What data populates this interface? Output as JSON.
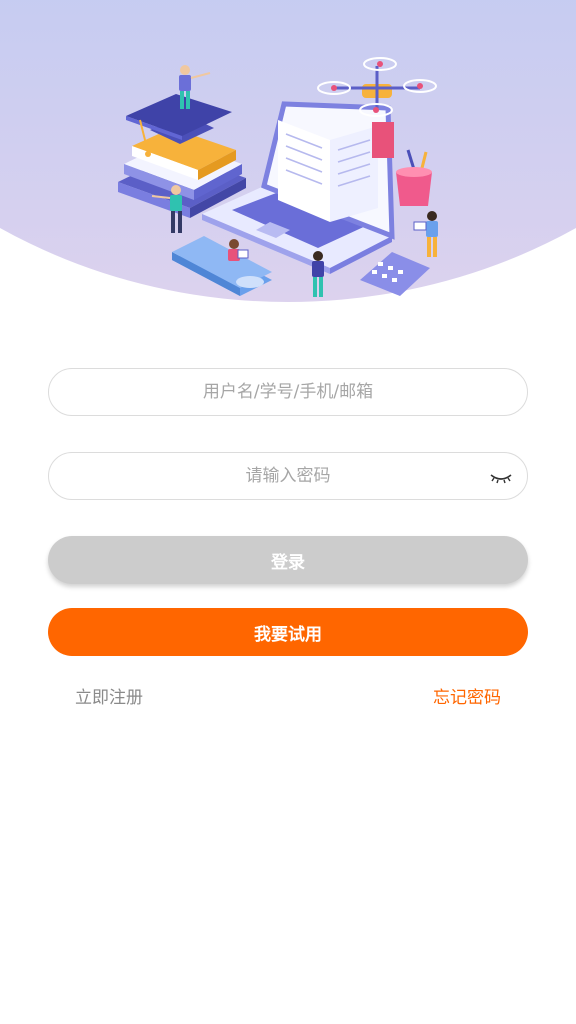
{
  "login_form": {
    "username_placeholder": "用户名/学号/手机/邮箱",
    "password_placeholder": "请输入密码",
    "password_toggle_icon": "eye-closed-icon",
    "login_label": "登录",
    "trial_label": "我要试用",
    "register_label": "立即注册",
    "forgot_label": "忘记密码"
  },
  "colors": {
    "accent": "#ff6600",
    "login_disabled": "#cccccc",
    "hero_top": "#a6c6f6",
    "hero_bottom": "#dcd2ee",
    "link_muted": "#8a8a8a"
  }
}
